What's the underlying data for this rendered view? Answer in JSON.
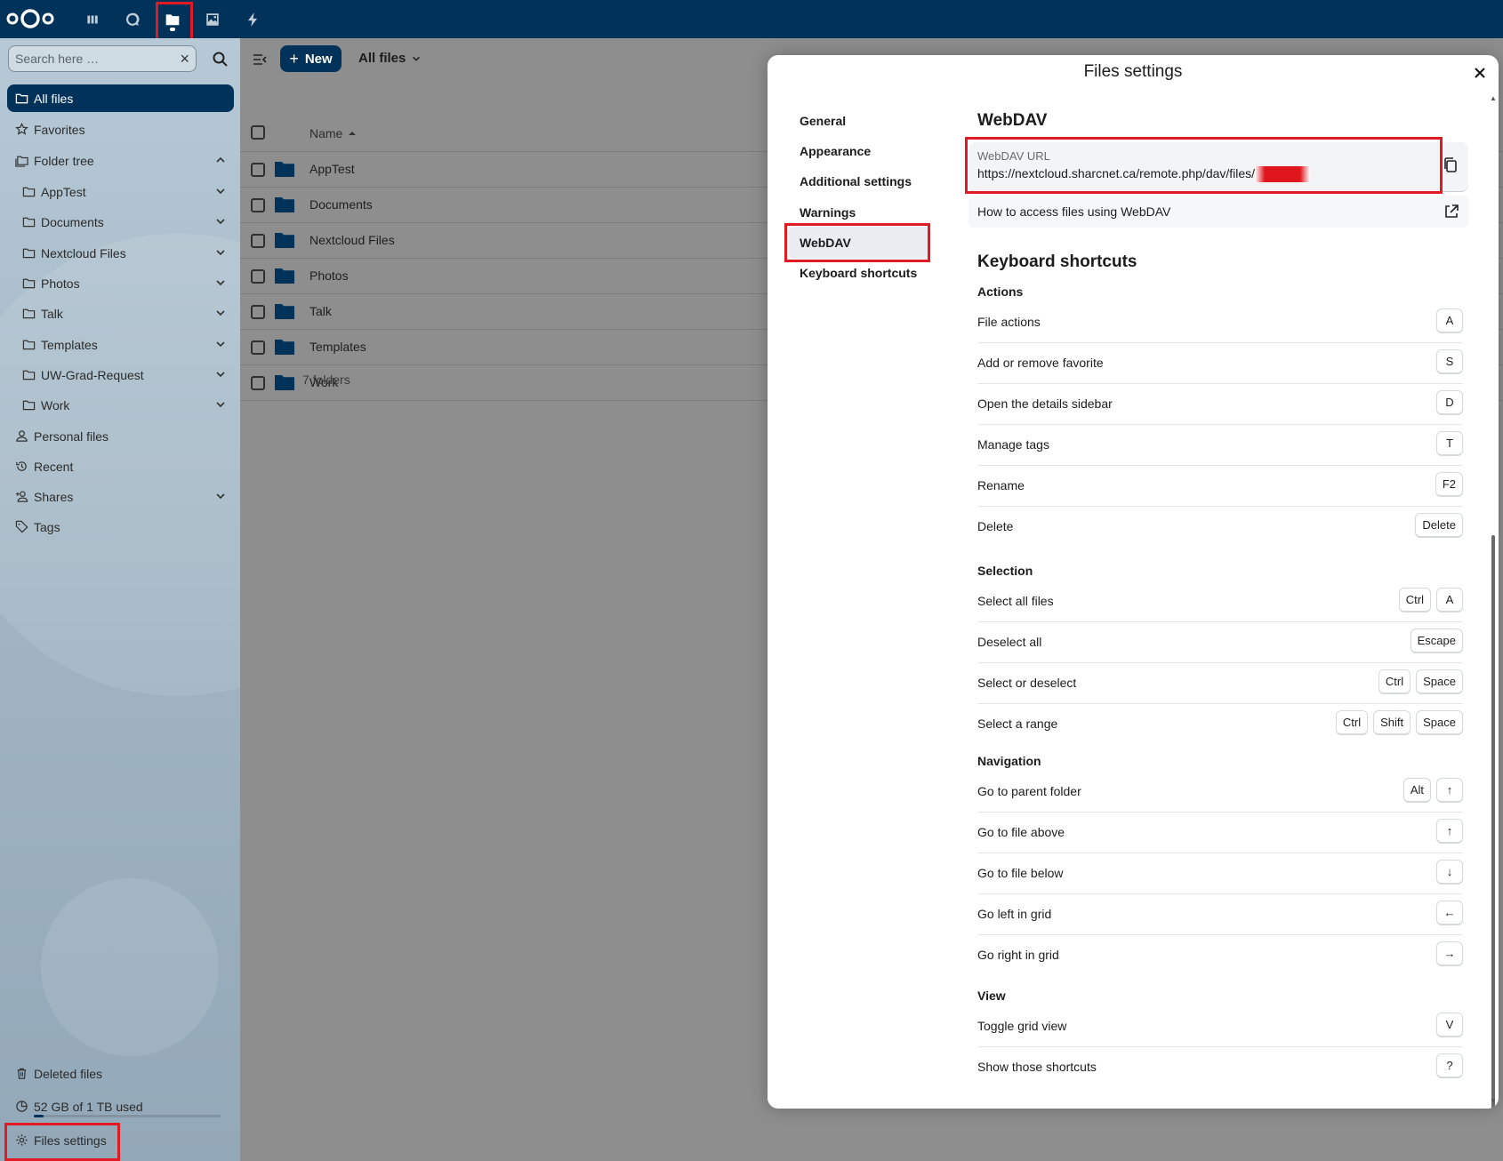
{
  "header": {
    "apps": [
      {
        "name": "dashboard",
        "icon": "dashboard-icon"
      },
      {
        "name": "talk",
        "icon": "talk-icon"
      },
      {
        "name": "files",
        "icon": "folder-icon",
        "active": true
      },
      {
        "name": "photos",
        "icon": "image-icon"
      },
      {
        "name": "activity",
        "icon": "lightning-icon"
      }
    ]
  },
  "sidebar": {
    "search_placeholder": "Search here …",
    "items": {
      "all_files": "All files",
      "favorites": "Favorites",
      "folder_tree": "Folder tree",
      "apptest": "AppTest",
      "documents": "Documents",
      "nextcloud_files": "Nextcloud Files",
      "photos": "Photos",
      "talk": "Talk",
      "templates": "Templates",
      "uw_grad": "UW-Grad-Request",
      "work": "Work",
      "personal_files": "Personal files",
      "recent": "Recent",
      "shares": "Shares",
      "tags": "Tags",
      "deleted_files": "Deleted files",
      "storage": "52 GB of 1 TB used",
      "files_settings": "Files settings"
    },
    "storage_fraction": 0.05
  },
  "main": {
    "new_button": "New",
    "breadcrumb": "All files",
    "name_header": "Name",
    "folders": [
      "AppTest",
      "Documents",
      "Nextcloud Files",
      "Photos",
      "Talk",
      "Templates",
      "Work"
    ],
    "summary": "7 folders"
  },
  "modal": {
    "title": "Files settings",
    "nav": {
      "general": "General",
      "appearance": "Appearance",
      "additional": "Additional settings",
      "warnings": "Warnings",
      "webdav": "WebDAV",
      "shortcuts": "Keyboard shortcuts"
    },
    "webdav": {
      "heading": "WebDAV",
      "url_label": "WebDAV URL",
      "url_value": "https://nextcloud.sharcnet.ca/remote.php/dav/files/",
      "howto": "How to access files using WebDAV"
    },
    "shortcuts": {
      "heading": "Keyboard shortcuts",
      "actions_heading": "Actions",
      "selection_heading": "Selection",
      "navigation_heading": "Navigation",
      "view_heading": "View",
      "actions": [
        {
          "label": "File actions",
          "keys": [
            "A"
          ]
        },
        {
          "label": "Add or remove favorite",
          "keys": [
            "S"
          ]
        },
        {
          "label": "Open the details sidebar",
          "keys": [
            "D"
          ]
        },
        {
          "label": "Manage tags",
          "keys": [
            "T"
          ]
        },
        {
          "label": "Rename",
          "keys": [
            "F2"
          ]
        },
        {
          "label": "Delete",
          "keys": [
            "Delete"
          ]
        }
      ],
      "selection": [
        {
          "label": "Select all files",
          "keys": [
            "Ctrl",
            "A"
          ]
        },
        {
          "label": "Deselect all",
          "keys": [
            "Escape"
          ]
        },
        {
          "label": "Select or deselect",
          "keys": [
            "Ctrl",
            "Space"
          ]
        },
        {
          "label": "Select a range",
          "keys": [
            "Ctrl",
            "Shift",
            "Space"
          ]
        }
      ],
      "navigation": [
        {
          "label": "Go to parent folder",
          "keys": [
            "Alt",
            "↑"
          ]
        },
        {
          "label": "Go to file above",
          "keys": [
            "↑"
          ]
        },
        {
          "label": "Go to file below",
          "keys": [
            "↓"
          ]
        },
        {
          "label": "Go left in grid",
          "keys": [
            "←"
          ]
        },
        {
          "label": "Go right in grid",
          "keys": [
            "→"
          ]
        }
      ],
      "view": [
        {
          "label": "Toggle grid view",
          "keys": [
            "V"
          ]
        },
        {
          "label": "Show those shortcuts",
          "keys": [
            "?"
          ]
        }
      ]
    }
  },
  "colors": {
    "primary": "#00325a",
    "highlight": "#e01b24"
  }
}
